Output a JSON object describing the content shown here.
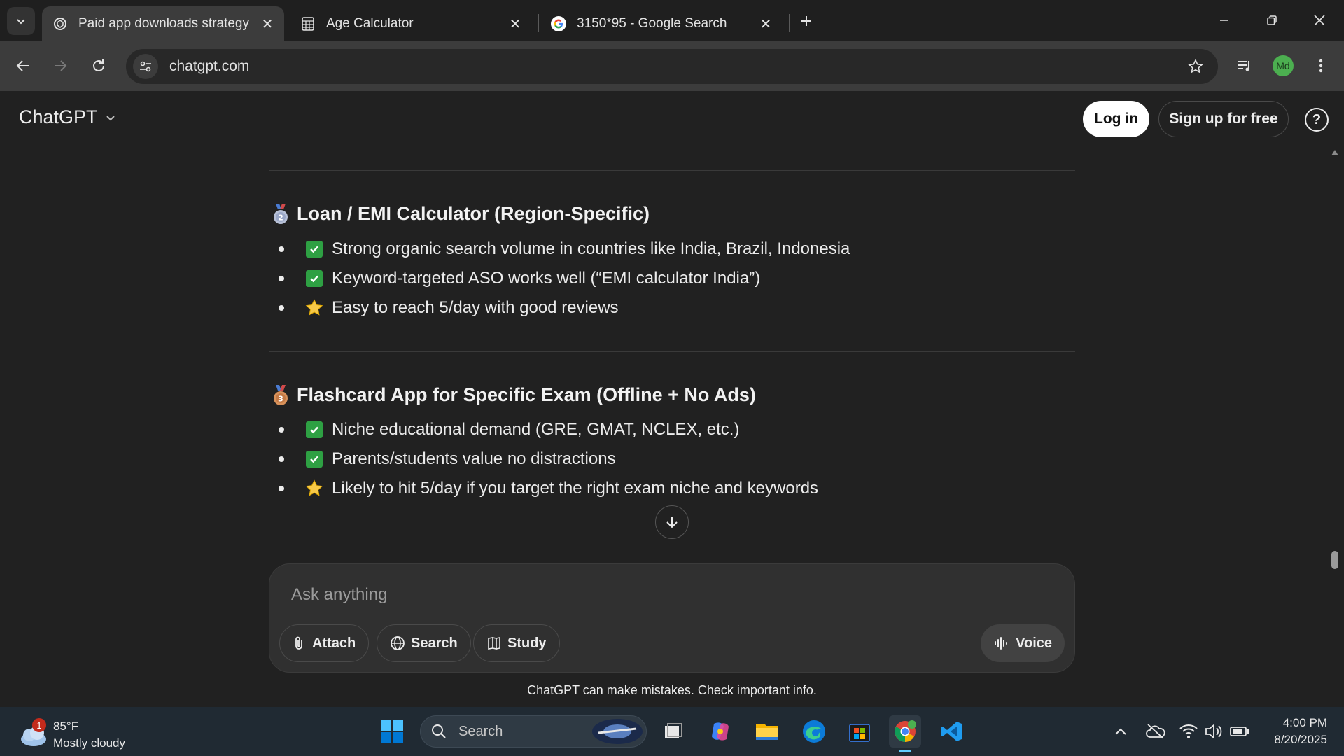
{
  "browser": {
    "tabs": [
      {
        "title": "Paid app downloads strategy",
        "icon": "chatgpt-icon",
        "active": true
      },
      {
        "title": "Age Calculator",
        "icon": "calculator-icon",
        "active": false
      },
      {
        "title": "3150*95 - Google Search",
        "icon": "google-icon",
        "active": false
      }
    ],
    "url": "chatgpt.com",
    "profile_initials": "Md"
  },
  "app": {
    "brand": "ChatGPT",
    "login_label": "Log in",
    "signup_label": "Sign up for free"
  },
  "sections": [
    {
      "medal": "2",
      "medal_color": "#9aa7c7",
      "title": "Loan / EMI Calculator (Region-Specific)",
      "items": [
        {
          "icon": "check",
          "text": "Strong organic search volume in countries like India, Brazil, Indonesia"
        },
        {
          "icon": "check",
          "text": "Keyword-targeted ASO works well (“EMI calculator India”)"
        },
        {
          "icon": "star",
          "text": "Easy to reach 5/day with good reviews"
        }
      ]
    },
    {
      "medal": "3",
      "medal_color": "#c47a45",
      "title": "Flashcard App for Specific Exam (Offline + No Ads)",
      "items": [
        {
          "icon": "check",
          "text": "Niche educational demand (GRE, GMAT, NCLEX, etc.)"
        },
        {
          "icon": "check",
          "text": "Parents/students value no distractions"
        },
        {
          "icon": "star",
          "text": "Likely to hit 5/day if you target the right exam niche and keywords"
        }
      ]
    }
  ],
  "composer": {
    "placeholder": "Ask anything",
    "attach_label": "Attach",
    "search_label": "Search",
    "study_label": "Study",
    "voice_label": "Voice"
  },
  "disclaimer": "ChatGPT can make mistakes. Check important info.",
  "taskbar": {
    "weather_temp": "85°F",
    "weather_desc": "Mostly cloudy",
    "weather_badge": "1",
    "search_label": "Search",
    "time": "4:00 PM",
    "date": "8/20/2025"
  },
  "colors": {
    "accent_check": "#2ea043",
    "star": "#f7c948",
    "login_bg": "#ffffff"
  }
}
